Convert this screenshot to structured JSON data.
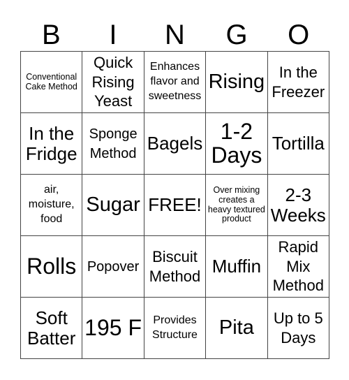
{
  "header": {
    "letters": [
      "B",
      "I",
      "N",
      "G",
      "O"
    ]
  },
  "grid": {
    "rows": [
      [
        "Conventional Cake Method",
        "Quick Rising Yeast",
        "Enhances flavor and sweetness",
        "Rising",
        "In the Freezer"
      ],
      [
        "In the Fridge",
        "Sponge Method",
        "Bagels",
        "1-2 Days",
        "Tortilla"
      ],
      [
        "air, moisture, food",
        "Sugar",
        "FREE!",
        "Over mixing creates a heavy textured product",
        "2-3 Weeks"
      ],
      [
        "Rolls",
        "Popover",
        "Biscuit Method",
        "Muffin",
        "Rapid Mix Method"
      ],
      [
        "Soft Batter",
        "195 F",
        "Provides Structure",
        "Pita",
        "Up to 5 Days"
      ]
    ],
    "free_space": "FREE!"
  }
}
